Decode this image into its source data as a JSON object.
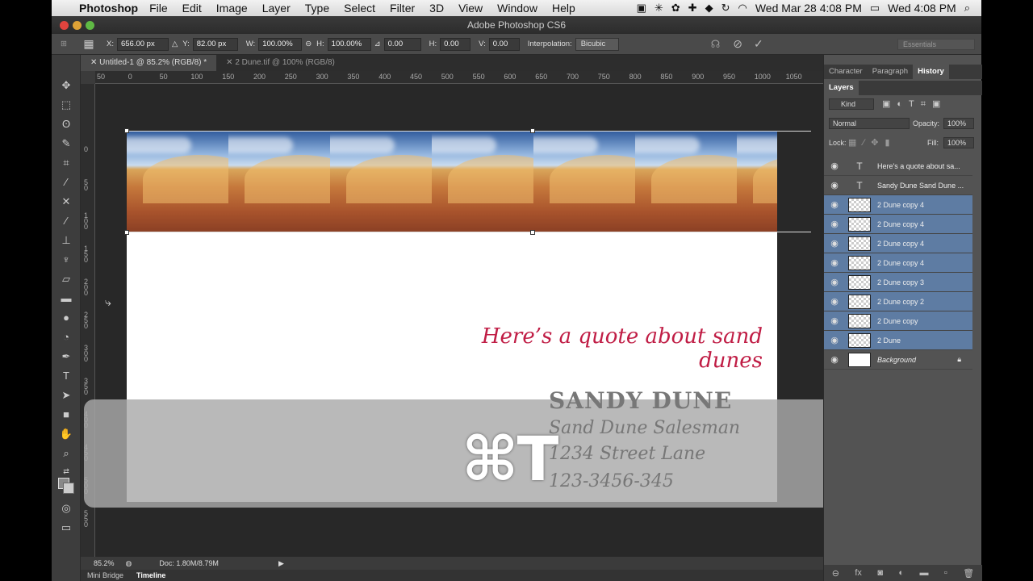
{
  "menubar": {
    "app": "Photoshop",
    "items": [
      "File",
      "Edit",
      "Image",
      "Layer",
      "Type",
      "Select",
      "Filter",
      "3D",
      "View",
      "Window",
      "Help"
    ],
    "clock1": "Wed Mar 28  4:08 PM",
    "clock2": "Wed 4:08 PM"
  },
  "window": {
    "title": "Adobe Photoshop CS6"
  },
  "options": {
    "x_label": "X:",
    "x_value": "656.00 px",
    "y_label": "Y:",
    "y_value": "82.00 px",
    "w_label": "W:",
    "w_value": "100.00%",
    "h_label": "H:",
    "h_value": "100.00%",
    "angle_value": "0.00",
    "hskew_label": "H:",
    "hskew_value": "0.00",
    "vskew_label": "V:",
    "vskew_value": "0.00",
    "interp_label": "Interpolation:",
    "interp_value": "Bicubic",
    "workspace": "Essentials"
  },
  "tabs": [
    {
      "label": "Untitled-1 @ 85.2% (RGB/8) *"
    },
    {
      "label": "2 Dune.tif @ 100% (RGB/8)"
    }
  ],
  "ruler": {
    "top": [
      "50",
      "0",
      "50",
      "100",
      "150",
      "200",
      "250",
      "300",
      "350",
      "400",
      "450",
      "500",
      "550",
      "600",
      "650",
      "700",
      "750",
      "800",
      "850",
      "900",
      "950",
      "1000",
      "1050"
    ],
    "left": [
      "0",
      "5 0",
      "1 0 0",
      "1 5 0",
      "2 0 0",
      "2 5 0",
      "3 0 0",
      "3 5 0",
      "4 0 0",
      "4 5 0",
      "5 0 0",
      "5 5 0"
    ]
  },
  "document": {
    "quote": "Here’s a quote about sand dunes",
    "name": "SANDY DUNE",
    "job": "Sand Dune Salesman",
    "address": "1234 Street Lane",
    "phone": "123-3456-345",
    "shortcut": "⌘T"
  },
  "status": {
    "zoom": "85.2%",
    "doc": "Doc: 1.80M/8.79M"
  },
  "bottom_tabs": [
    "Mini Bridge",
    "Timeline"
  ],
  "panels": {
    "top_tabs": [
      "Character",
      "Paragraph",
      "History"
    ],
    "layers_tab": "Layers",
    "kind": "Kind",
    "blend": "Normal",
    "opacity_label": "Opacity:",
    "opacity": "100%",
    "lock_label": "Lock:",
    "fill_label": "Fill:",
    "fill": "100%",
    "layers": [
      {
        "name": "Here's a quote about sa...",
        "type": "text",
        "selected": false
      },
      {
        "name": "Sandy Dune Sand Dune ...",
        "type": "text",
        "selected": false
      },
      {
        "name": "2 Dune copy 4",
        "type": "image",
        "selected": true
      },
      {
        "name": "2 Dune copy 4",
        "type": "image",
        "selected": true
      },
      {
        "name": "2 Dune copy 4",
        "type": "image",
        "selected": true
      },
      {
        "name": "2 Dune copy 4",
        "type": "image",
        "selected": true
      },
      {
        "name": "2 Dune copy 3",
        "type": "image",
        "selected": true
      },
      {
        "name": "2 Dune copy 2",
        "type": "image",
        "selected": true
      },
      {
        "name": "2 Dune copy",
        "type": "image",
        "selected": true
      },
      {
        "name": "2 Dune",
        "type": "image",
        "selected": true
      },
      {
        "name": "Background",
        "type": "background",
        "selected": false
      }
    ]
  }
}
